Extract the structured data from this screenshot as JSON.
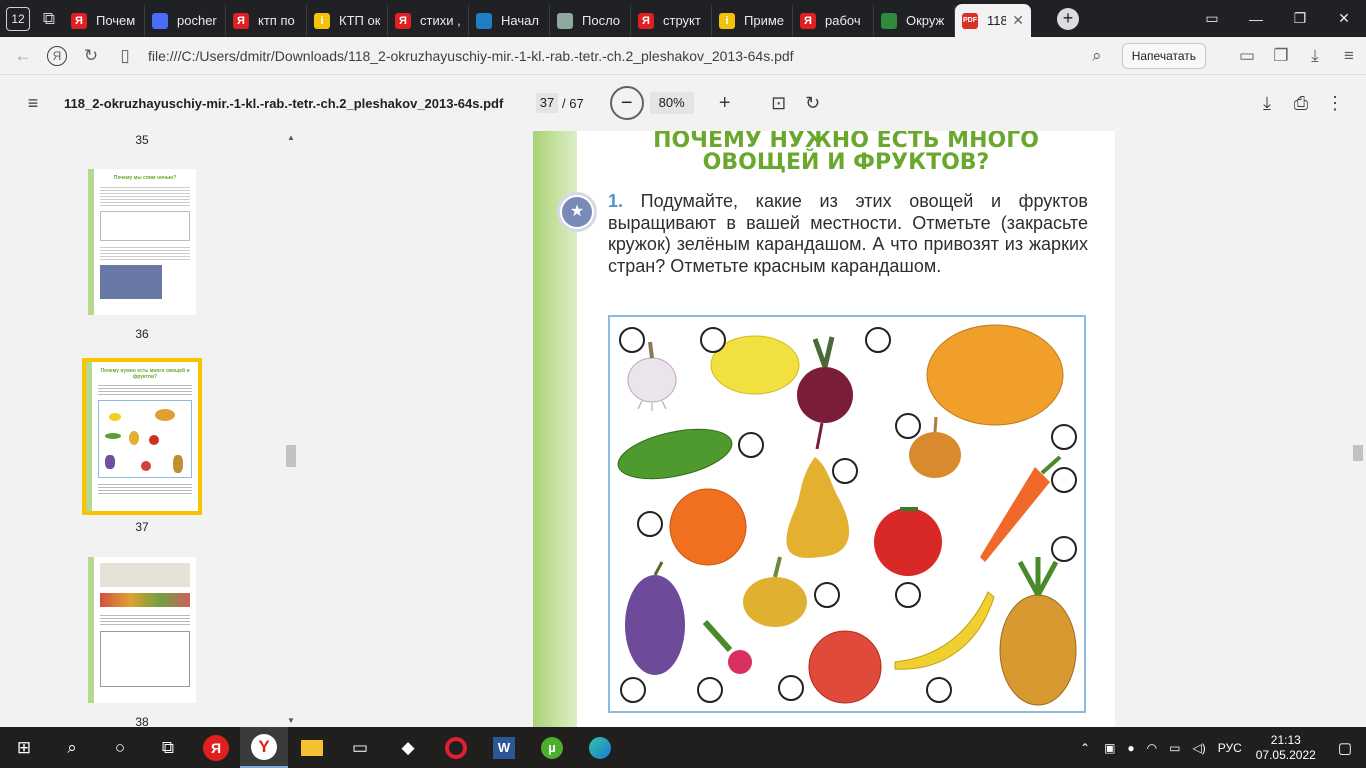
{
  "browser": {
    "tab_count": "12",
    "tabs": [
      {
        "label": "Почем",
        "color": "#e02020",
        "glyph": "Я"
      },
      {
        "label": "pocher",
        "color": "#4a6cf7",
        "glyph": ""
      },
      {
        "label": "ктп по",
        "color": "#e02020",
        "glyph": "Я"
      },
      {
        "label": "КТП ок",
        "color": "#f4c20d",
        "glyph": "i"
      },
      {
        "label": "стихи ,",
        "color": "#e02020",
        "glyph": "Я"
      },
      {
        "label": "Начал",
        "color": "#1e7fc4",
        "glyph": ""
      },
      {
        "label": "Посло",
        "color": "#8fa8a0",
        "glyph": ""
      },
      {
        "label": "структ",
        "color": "#e02020",
        "glyph": "Я"
      },
      {
        "label": "Приме",
        "color": "#f4c20d",
        "glyph": "i"
      },
      {
        "label": "рабоч",
        "color": "#e02020",
        "glyph": "Я"
      },
      {
        "label": "Окруж",
        "color": "#2e8b3e",
        "glyph": ""
      }
    ],
    "active_tab": {
      "label": "118_",
      "icon": "PDF"
    },
    "url": "file:///C:/Users/dmitr/Downloads/118_2-okruzhayuschiy-mir.-1-kl.-rab.-tetr.-ch.2_pleshakov_2013-64s.pdf",
    "print_label": "Напечатать",
    "yandex_glyph": "Я"
  },
  "pdf": {
    "filename": "118_2-okruzhayuschiy-mir.-1-kl.-rab.-tetr.-ch.2_pleshakov_2013-64s.pdf",
    "page_current": "37",
    "page_total": "/ 67",
    "zoom": "80%",
    "thumbs": {
      "p35": "35",
      "p36": "36",
      "p37": "37",
      "p38": "38"
    },
    "thumb36_title": "Почему мы спим ночью?",
    "thumb37_title": "Почему нужно есть много овощей и фруктов?",
    "heading_line1": "ПОЧЕМУ НУЖНО ЕСТЬ МНОГО",
    "heading_line2": "ОВОЩЕЙ И ФРУКТОВ?",
    "task_number": "1.",
    "task_text": "Подумайте, какие из этих овощей и фруктов выращивают в вашей местности. Отметьте (закрасьте кружок) зелёным карандашом. А что привозят из жарких стран? Отметьте красным карандашом."
  },
  "fruits": [
    "garlic",
    "lemon",
    "beet",
    "melon",
    "cucumber",
    "onion",
    "orange",
    "pear",
    "tomato",
    "carrot",
    "grapes",
    "radish",
    "turnip",
    "apple",
    "banana",
    "pineapple"
  ],
  "taskbar": {
    "lang": "РУС",
    "time": "21:13",
    "date": "07.05.2022"
  }
}
